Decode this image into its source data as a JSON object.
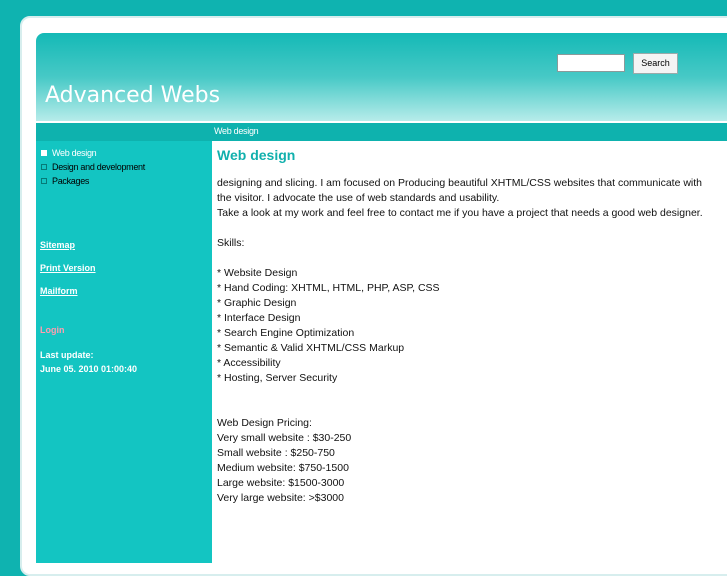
{
  "header": {
    "site_title": "Advanced Webs",
    "search": {
      "placeholder": "",
      "button_label": "Search"
    }
  },
  "nav": {
    "breadcrumb": "Web design"
  },
  "sidebar": {
    "menu": [
      {
        "label": "Web design",
        "active": true
      },
      {
        "label": "Design and development",
        "active": false
      },
      {
        "label": "Packages",
        "active": false
      }
    ],
    "links": {
      "sitemap": "Sitemap",
      "print": "Print Version",
      "mailform": "Mailform"
    },
    "login": "Login",
    "last_update_label": "Last update:",
    "last_update_value": "June 05. 2010 01:00:40"
  },
  "content": {
    "title": "Web design",
    "intro_1": "designing and slicing. I am focused on Producing beautiful XHTML/CSS websites that communicate with the visitor. I advocate the use of web standards and usability.",
    "intro_2": "Take a look at my work and feel free to contact me if you have a project that needs a good web designer.",
    "skills_heading": "Skills:",
    "skills": [
      " * Website Design",
      " * Hand Coding: XHTML, HTML, PHP, ASP, CSS",
      " * Graphic Design",
      " * Interface Design",
      " * Search Engine Optimization",
      " * Semantic & Valid XHTML/CSS Markup",
      " * Accessibility",
      " * Hosting, Server Security"
    ],
    "pricing_heading": "Web Design Pricing:",
    "pricing": [
      "Very small website : $30-250",
      "Small website : $250-750",
      "Medium website: $750-1500",
      "Large website: $1500-3000",
      "Very large website:  >$3000"
    ]
  },
  "colors": {
    "accent": "#0eb2ae",
    "sidebar_bg": "#13c5c2",
    "title_color": "#11b0ad",
    "login_color": "#ff9db0"
  }
}
